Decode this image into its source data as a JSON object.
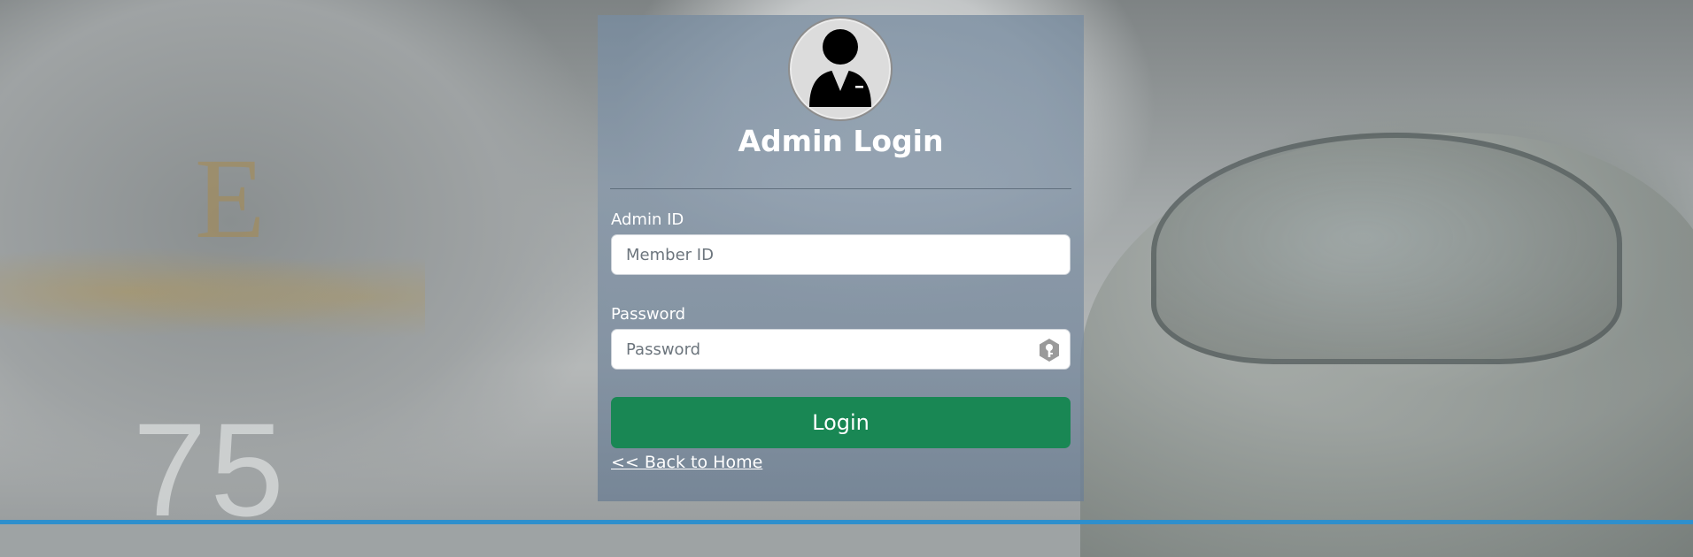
{
  "page": {
    "title": "Admin Login",
    "accent_color": "#198754",
    "bottom_bar_color": "#2f8fcc"
  },
  "avatar": {
    "icon": "admin-user-icon"
  },
  "form": {
    "admin_id_label": "Admin ID",
    "admin_id_placeholder": "Member ID",
    "admin_id_value": "",
    "password_label": "Password",
    "password_placeholder": "Password",
    "password_value": "",
    "password_icon": "key-icon",
    "login_button_label": "Login"
  },
  "links": {
    "back_home_label": "<< Back to Home"
  },
  "background": {
    "decor_letter": "E",
    "decor_number": "75"
  }
}
